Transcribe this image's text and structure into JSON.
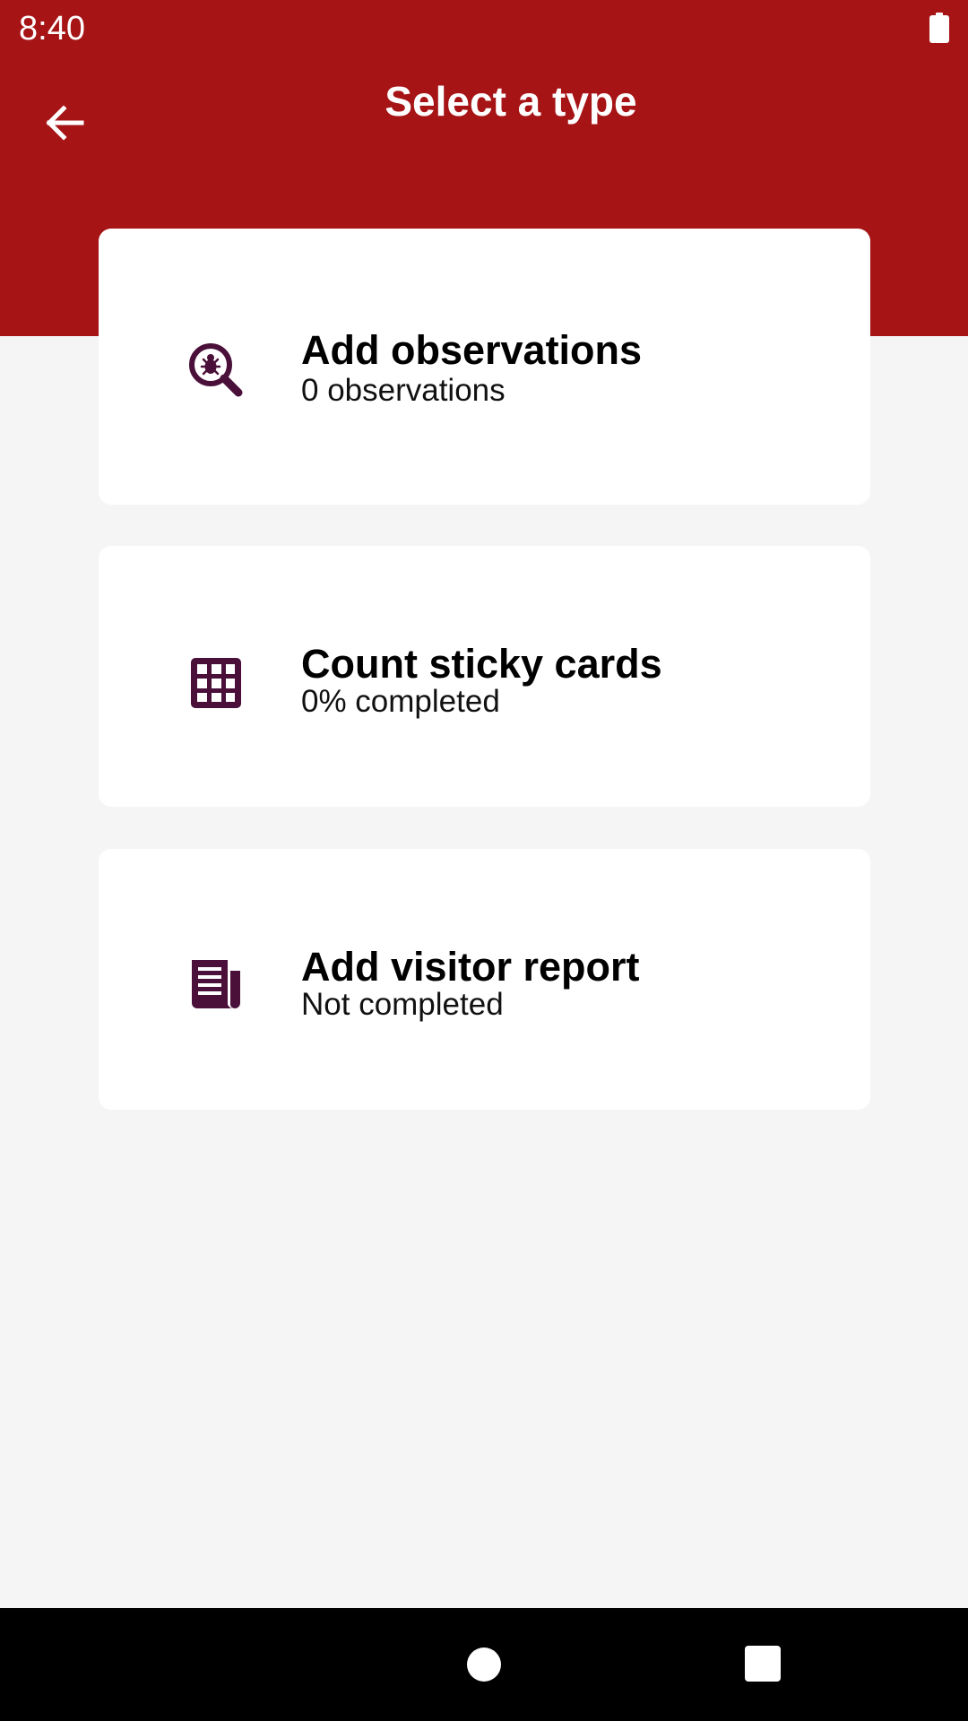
{
  "status_bar": {
    "time": "8:40"
  },
  "header": {
    "title": "Select a type",
    "background_color": "#a61416"
  },
  "colors": {
    "icon": "#4a1039",
    "card_background": "#ffffff",
    "page_background": "#f5f5f5"
  },
  "cards": [
    {
      "icon": "bug-search-icon",
      "title": "Add observations",
      "subtitle": "0 observations"
    },
    {
      "icon": "grid-icon",
      "title": "Count sticky cards",
      "subtitle": "0% completed"
    },
    {
      "icon": "newspaper-icon",
      "title": "Add visitor report",
      "subtitle": "Not completed"
    }
  ]
}
